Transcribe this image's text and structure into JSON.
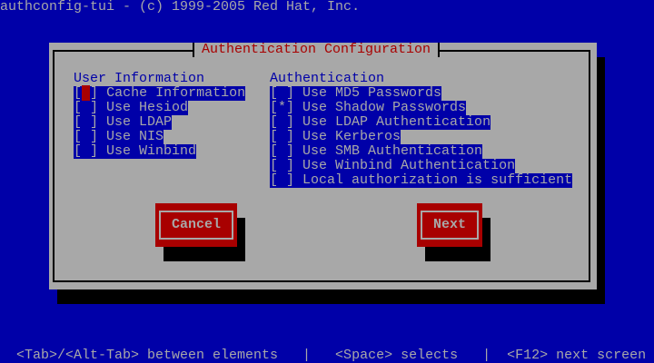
{
  "top_title": "authconfig-tui - (c) 1999-2005 Red Hat, Inc.",
  "dialog": {
    "title": "Authentication Configuration",
    "user_info": {
      "heading": "User Information",
      "items": [
        {
          "check": "[ ]",
          "label": "Cache Information",
          "checked": false,
          "focused": true
        },
        {
          "check": "[ ]",
          "label": "Use Hesiod",
          "checked": false
        },
        {
          "check": "[ ]",
          "label": "Use LDAP",
          "checked": false
        },
        {
          "check": "[ ]",
          "label": "Use NIS",
          "checked": false
        },
        {
          "check": "[ ]",
          "label": "Use Winbind",
          "checked": false
        }
      ]
    },
    "authentication": {
      "heading": "Authentication",
      "items": [
        {
          "check": "[ ]",
          "label": "Use MD5 Passwords",
          "checked": false
        },
        {
          "check": "[*]",
          "label": "Use Shadow Passwords",
          "checked": true
        },
        {
          "check": "[ ]",
          "label": "Use LDAP Authentication",
          "checked": false
        },
        {
          "check": "[ ]",
          "label": "Use Kerberos",
          "checked": false
        },
        {
          "check": "[ ]",
          "label": "Use SMB Authentication",
          "checked": false
        },
        {
          "check": "[ ]",
          "label": "Use Winbind Authentication",
          "checked": false
        },
        {
          "check": "[ ]",
          "label": "Local authorization is sufficient",
          "checked": false
        }
      ]
    },
    "cancel_label": "Cancel",
    "next_label": "Next"
  },
  "status_bar": "  <Tab>/<Alt-Tab> between elements   |   <Space> selects   |  <F12> next screen"
}
